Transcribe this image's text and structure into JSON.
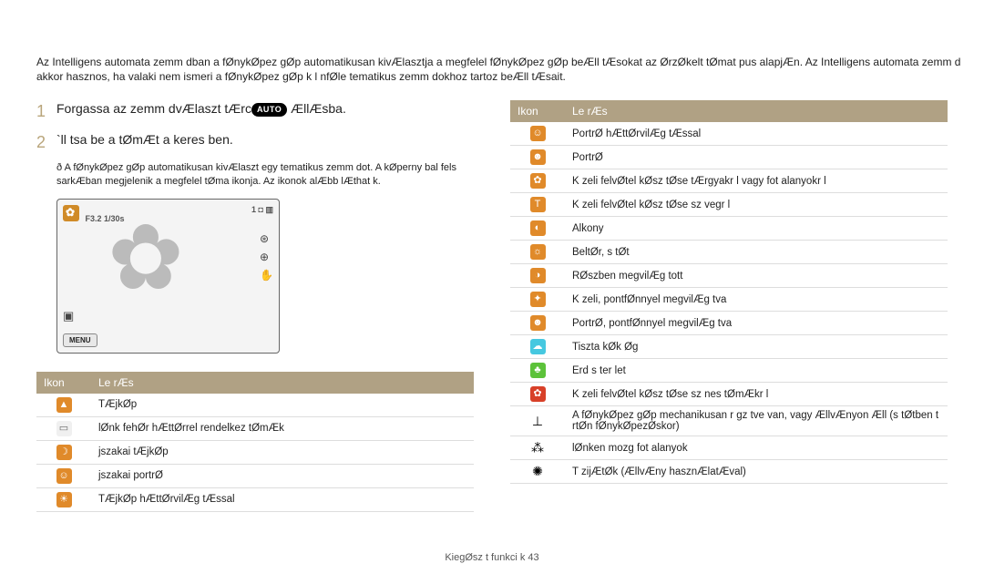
{
  "intro": "Az Intelligens automata  zemm dban a fØnykØpez gØp automatikusan kivÆlasztja a megfelel  fØnykØpez gØp beÆll tÆsokat az ØrzØkelt tØmat pus alapjÆn. Az Intelligens automata  zemm d akkor hasznos, ha valaki nem ismeri a fØnykØpez gØp k l nfØle tematikus  zemm dokhoz tartoz  beÆll tÆsait.",
  "steps": {
    "s1_pre": "Forgassa az  zemm dvÆlaszt  tÆrc",
    "s1_post": " ÆllÆsba.",
    "s2": "`ll tsa be a tØmÆt a keres ben."
  },
  "mode_badge": "AUTO",
  "note": "ð A fØnykØpez gØp automatikusan kivÆlaszt egy tematikus  zemm dot. A kØperny  bal fels  sarkÆban megjelenik a megfelel  tØma ikonja. Az ikonok alÆbb lÆthat k.",
  "preview": {
    "exposure": "F3.2  1/30s",
    "count": "1",
    "menu": "MENU"
  },
  "table_headers": {
    "icon": "Ikon",
    "desc": "Le rÆs"
  },
  "left_rows": [
    {
      "glyph": "▲",
      "bg": "#e08a2a",
      "desc": "TÆjkØp"
    },
    {
      "glyph": "▭",
      "bg": "#f0f0f0",
      "fgdark": true,
      "desc": "lØnk fehØr hÆttØrrel rendelkez  tØmÆk"
    },
    {
      "glyph": "☽",
      "bg": "#e08a2a",
      "desc": "jszakai tÆjkØp"
    },
    {
      "glyph": "☺",
      "bg": "#e08a2a",
      "desc": "jszakai portrØ"
    },
    {
      "glyph": "☀",
      "bg": "#e08a2a",
      "desc": "TÆjkØp hÆttØrvilÆg tÆssal"
    }
  ],
  "right_rows": [
    {
      "glyph": "☺",
      "bg": "#e08a2a",
      "desc": "PortrØ hÆttØrvilÆg tÆssal"
    },
    {
      "glyph": "☻",
      "bg": "#e08a2a",
      "desc": "PortrØ"
    },
    {
      "glyph": "✿",
      "bg": "#e08a2a",
      "desc": "K zeli felvØtel kØsz tØse tÆrgyakr l vagy fot alanyokr l"
    },
    {
      "glyph": "T",
      "bg": "#e08a2a",
      "desc": "K zeli felvØtel kØsz tØse sz vegr l"
    },
    {
      "glyph": "◐",
      "bg": "#e08a2a",
      "desc": "Alkony"
    },
    {
      "glyph": "☼",
      "bg": "#e08a2a",
      "desc": "BeltØr, s tØt"
    },
    {
      "glyph": "◑",
      "bg": "#e08a2a",
      "desc": "RØszben megvilÆg tott"
    },
    {
      "glyph": "✦",
      "bg": "#e08a2a",
      "desc": "K zeli, pontfØnnyel megvilÆg tva"
    },
    {
      "glyph": "☻",
      "bg": "#e08a2a",
      "desc": "PortrØ, pontfØnnyel megvilÆg tva"
    },
    {
      "glyph": "☁",
      "bg": "#46c8e0",
      "desc": "Tiszta kØk Øg"
    },
    {
      "glyph": "♣",
      "bg": "#5cc23a",
      "desc": "Erd s ter let"
    },
    {
      "glyph": "✿",
      "bg": "#d84028",
      "desc": "K zeli felvØtel kØsz tØse sz nes tØmÆkr l"
    },
    {
      "glyph": "⊥",
      "plain": true,
      "desc": "A fØnykØpez gØp mechanikusan r gz tve van, vagy ÆllvÆnyon Æll (s tØtben t rtØn  fØnykØpezØskor)"
    },
    {
      "glyph": "⁂",
      "plain": true,
      "desc": " lØnken mozg  fot alanyok"
    },
    {
      "glyph": "✺",
      "plain": true,
      "desc": "T zijÆtØk (ÆllvÆny hasznÆlatÆval)"
    }
  ],
  "footer": {
    "label": "KiegØsz t  funkci k",
    "page": "43"
  }
}
